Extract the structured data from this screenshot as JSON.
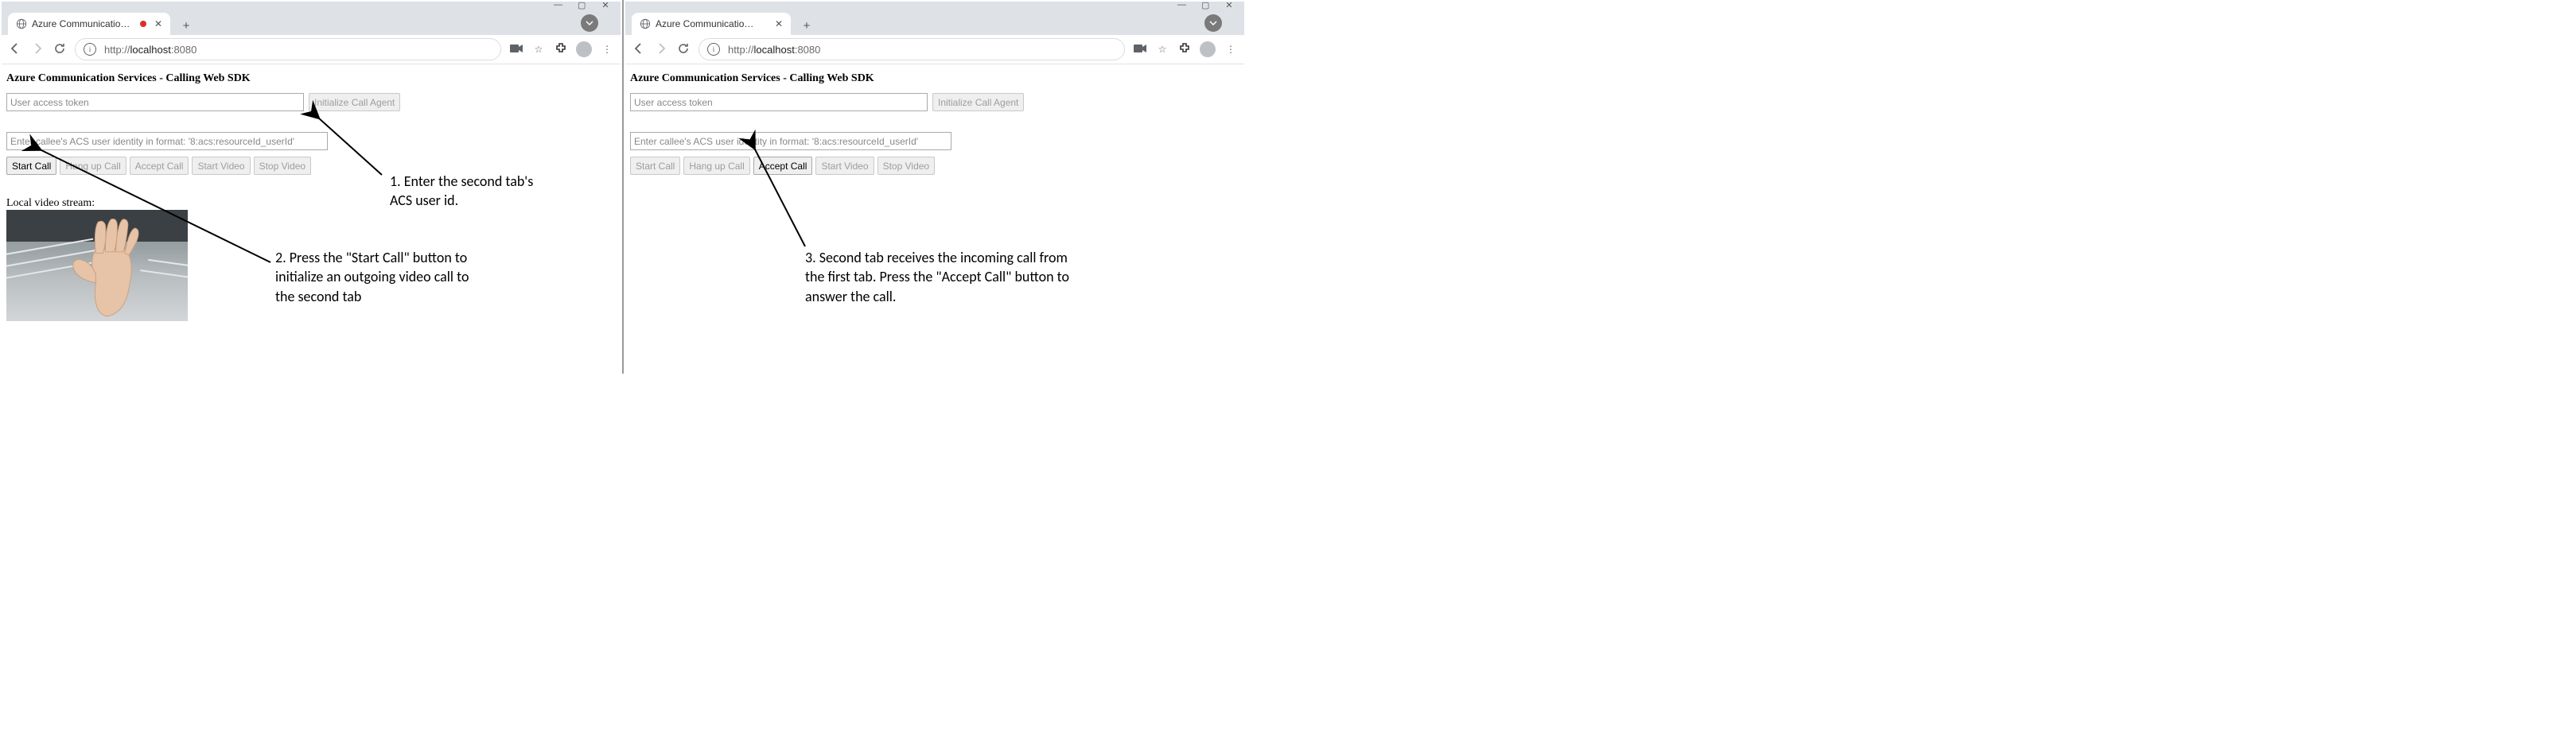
{
  "left": {
    "tab_title": "Azure Communication Servi…",
    "url_prefix": "http://",
    "url_host": "localhost",
    "url_port": ":8080",
    "heading": "Azure Communication Services - Calling Web SDK",
    "token_placeholder": "User access token",
    "init_agent_label": "Initialize Call Agent",
    "callee_placeholder": "Enter callee's ACS user identity in format: '8:acs:resourceId_userId'",
    "buttons": {
      "start": "Start Call",
      "hangup": "Hang up Call",
      "accept": "Accept Call",
      "startvideo": "Start Video",
      "stopvideo": "Stop Video"
    },
    "local_video_label": "Local video stream:"
  },
  "right": {
    "tab_title": "Azure Communication Services",
    "url_prefix": "http://",
    "url_host": "localhost",
    "url_port": ":8080",
    "heading": "Azure Communication Services - Calling Web SDK",
    "token_placeholder": "User access token",
    "init_agent_label": "Initialize Call Agent",
    "callee_placeholder": "Enter callee's ACS user identity in format: '8:acs:resourceId_userId'",
    "buttons": {
      "start": "Start Call",
      "hangup": "Hang up Call",
      "accept": "Accept Call",
      "startvideo": "Start Video",
      "stopvideo": "Stop Video"
    }
  },
  "annotations": {
    "a1_l1": "1. Enter the second tab's",
    "a1_l2": "ACS user id.",
    "a2_l1": "2. Press the \"Start Call\" button to",
    "a2_l2": "initialize an outgoing video call to",
    "a2_l3": "the second tab",
    "a3_l1": "3. Second tab receives the incoming call from",
    "a3_l2": "the first tab. Press the \"Accept Call\" button to",
    "a3_l3": "answer the call."
  }
}
